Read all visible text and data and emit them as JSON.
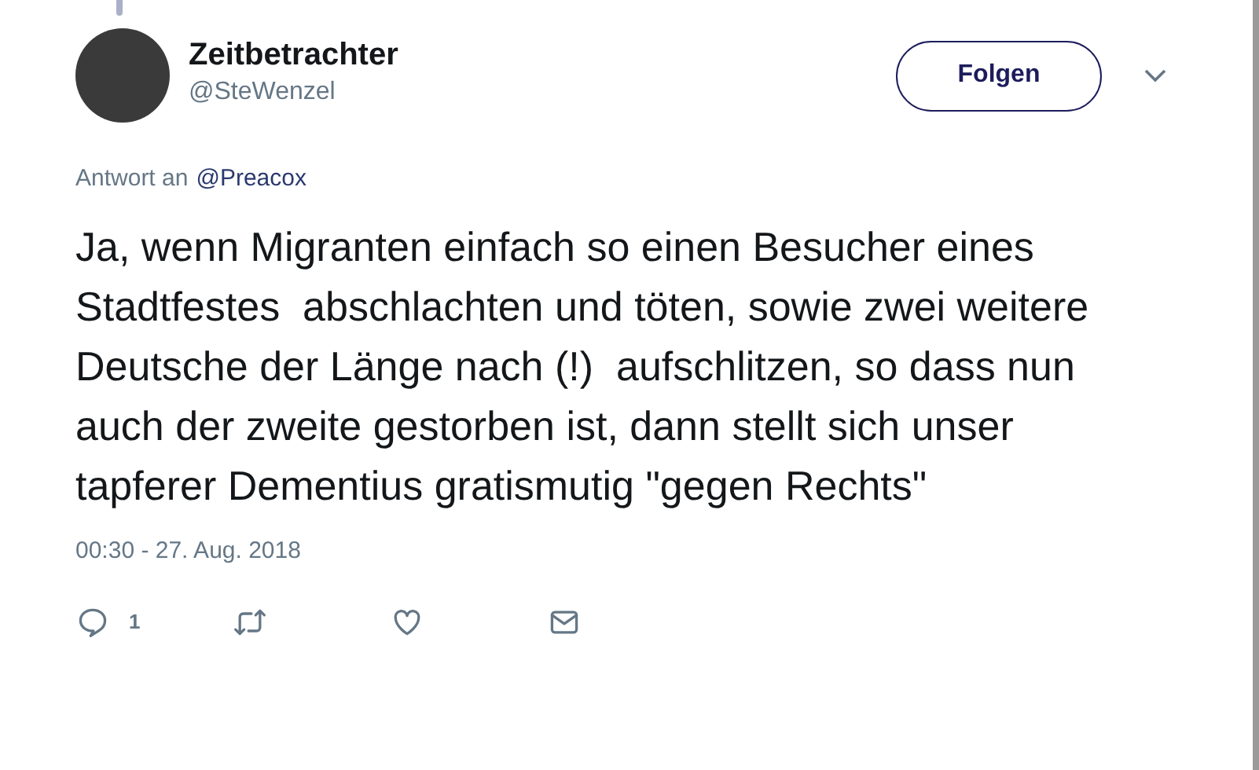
{
  "author": {
    "name": "Zeitbetrachter",
    "handle": "@SteWenzel"
  },
  "follow_button": {
    "label": "Folgen"
  },
  "reply_to": {
    "prefix": "Antwort an",
    "mention": "@Preacox"
  },
  "tweet_text": "Ja, wenn Migranten einfach so einen Besucher eines Stadtfestes  abschlachten und töten, sowie zwei weitere Deutsche der Länge nach (!)  aufschlitzen, so dass nun auch der zweite gestorben ist, dann stellt sich unser tapferer Dementius gratismutig \"gegen Rechts\"",
  "timestamp": "00:30 - 27. Aug. 2018",
  "actions": [
    {
      "kind": "reply",
      "count": "1"
    },
    {
      "kind": "retweet"
    },
    {
      "kind": "like"
    },
    {
      "kind": "message"
    }
  ]
}
